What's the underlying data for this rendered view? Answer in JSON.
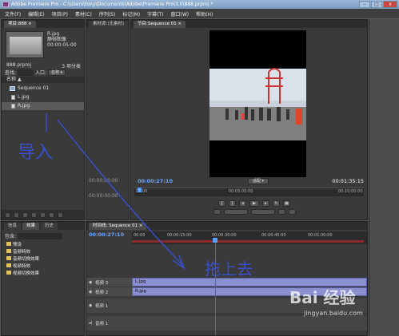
{
  "window": {
    "title": "Adobe Premiere Pro - C:\\Users\\tony\\Documents\\Adobe\\Premiere Pro\\3.0\\888.prproj *",
    "controls": {
      "minimize": "–",
      "maximize": "□",
      "close": "x"
    }
  },
  "menu": [
    "文件(F)",
    "编辑(E)",
    "项目(P)",
    "素材(C)",
    "序列(S)",
    "标记(M)",
    "字幕(T)",
    "窗口(W)",
    "帮助(H)"
  ],
  "project": {
    "tab": "项目:888",
    "close": "×",
    "thumb_name": "R.jpg",
    "thumb_type": "静帧图像",
    "thumb_duration": "00:00:05:00",
    "project_file": "888.prproj",
    "item_count": "3 项分类",
    "find_label": "查找:",
    "in_label": "入口:",
    "in_value": "名称",
    "column_name": "名称",
    "items": [
      {
        "name": "Sequence 01"
      },
      {
        "name": "L.jpg"
      },
      {
        "name": "R.jpg"
      }
    ],
    "bottom_tc": "00:00:00:00"
  },
  "source": {
    "tab": "素材源:(无素材)",
    "tc_left": "00:00:00:00",
    "tc_right": "00:00:00:00"
  },
  "program": {
    "tab": "节目:Sequence 01",
    "close": "×",
    "tc_current": "00:00:27:10",
    "fit": "适配",
    "tc_duration": "00:01:35:15",
    "ruler": [
      "00:00",
      "00:05:00:00",
      "00:10:00:00"
    ]
  },
  "effects": {
    "tabs": [
      "信息",
      "效果",
      "历史"
    ],
    "search_label": "包含:",
    "folders": [
      "预设",
      "音频特效",
      "音频切换效果",
      "视频特效",
      "视频切换效果"
    ]
  },
  "timeline": {
    "tab": "时间线: Sequence 01",
    "close": "×",
    "tc": "00:00:27:10",
    "ruler": [
      "00:00",
      "00:00:15:00",
      "00:00:30:00",
      "00:00:45:00",
      "00:01:00:00"
    ],
    "video_tracks": [
      {
        "name": "视频 3",
        "clip": "L.jpg"
      },
      {
        "name": "视频 2",
        "clip": "R.jpg"
      },
      {
        "name": "视频 1",
        "clip": ""
      }
    ],
    "audio_tracks": [
      {
        "name": "音频 1"
      }
    ]
  },
  "annotations": {
    "import": "导入",
    "drag": "拖上去"
  },
  "watermark": {
    "brand": "Bai  经验",
    "url": "jingyan.baidu.com"
  },
  "colors": {
    "timecode": "#6aa6ff",
    "playhead": "#ff2a2a",
    "clip": "#8a8fd0",
    "annotation": "#3a4fd0"
  }
}
